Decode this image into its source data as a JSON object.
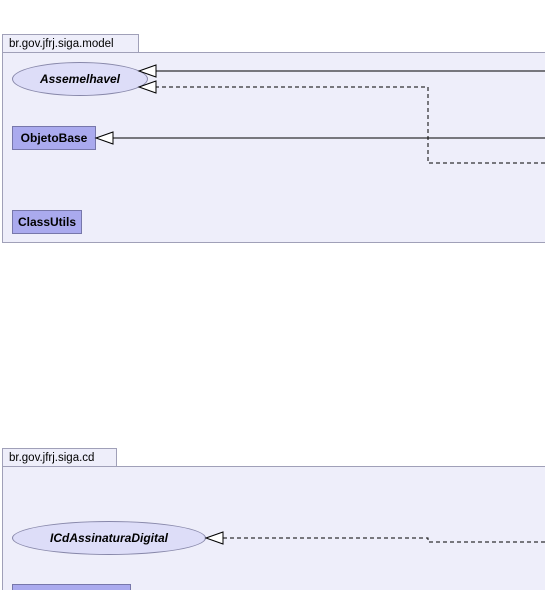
{
  "packages": [
    {
      "name": "br.gov.jfrj.siga.model",
      "items": [
        {
          "label": "Assemelhavel",
          "kind": "interface"
        },
        {
          "label": "ObjetoBase",
          "kind": "class"
        },
        {
          "label": "ClassUtils",
          "kind": "class"
        }
      ]
    },
    {
      "name": "br.gov.jfrj.siga.cd",
      "items": [
        {
          "label": "ICdAssinaturaDigital",
          "kind": "interface"
        }
      ]
    }
  ],
  "colors": {
    "package_fill": "#eeeefa",
    "package_border": "#a0a0b8",
    "class_fill": "#aaaaee",
    "interface_fill": "#ddddf8",
    "edge": "#000000"
  }
}
